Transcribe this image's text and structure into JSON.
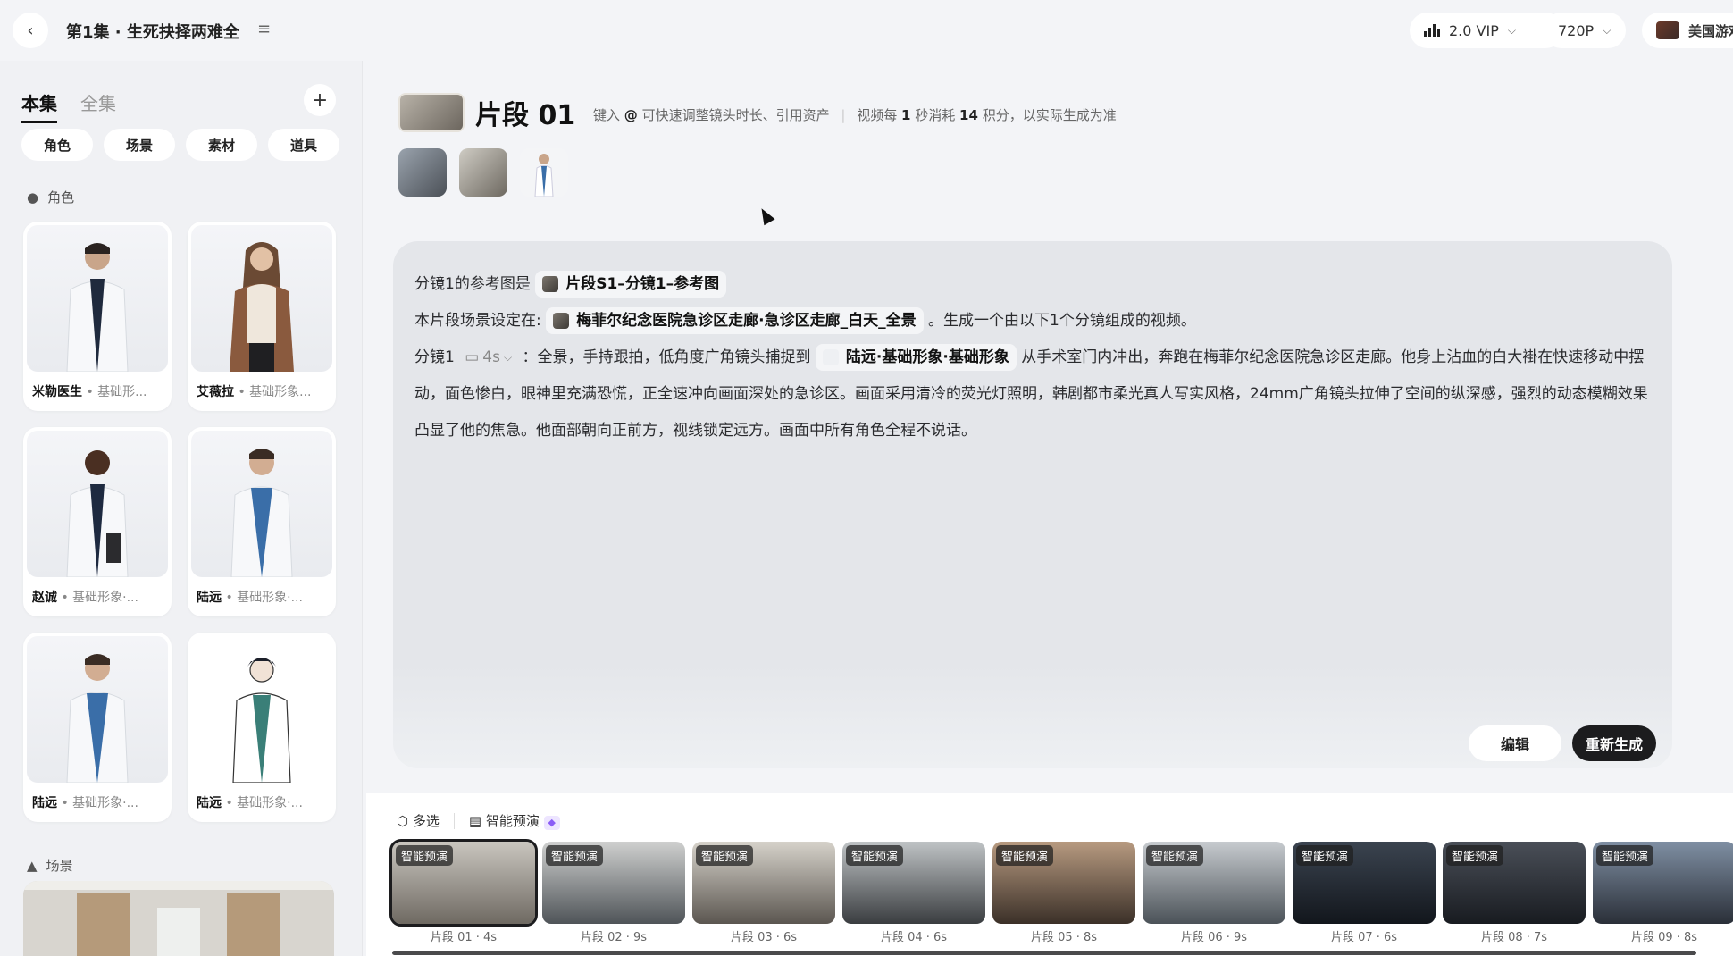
{
  "header": {
    "episode_title": "第1集 · 生死抉择两难全",
    "model_label": "2.0 VIP",
    "resolution_label": "720P",
    "user_label": "美国游戏"
  },
  "sidebar": {
    "tabs": [
      {
        "label": "本集",
        "active": true
      },
      {
        "label": "全集",
        "active": false
      }
    ],
    "filters": [
      "角色",
      "场景",
      "素材",
      "道具"
    ],
    "characters_section": "角色",
    "characters": [
      {
        "name": "米勒医生",
        "tag": "• 基础形..."
      },
      {
        "name": "艾薇拉",
        "tag": "• 基础形象..."
      },
      {
        "name": "赵诚",
        "tag": "• 基础形象·..."
      },
      {
        "name": "陆远",
        "tag": "• 基础形象·..."
      },
      {
        "name": "陆远",
        "tag": "• 基础形象·..."
      },
      {
        "name": "陆远",
        "tag": "• 基础形象·..."
      }
    ],
    "scenes_section": "场景"
  },
  "clip": {
    "title": "片段 01",
    "hint_pre": "键入",
    "hint_at": "@",
    "hint_mid": "可快速调整镜头时长、引用资产",
    "hint_cost_pre": "视频每",
    "hint_cost_sec": "1",
    "hint_cost_mid": "秒消耗",
    "hint_cost_points": "14",
    "hint_cost_post": "积分，以实际生成为准"
  },
  "prompt": {
    "line1_pre": "分镜1的参考图是",
    "line1_ref": "片段S1–分镜1–参考图",
    "line2_pre": "本片段场景设定在:",
    "line2_ref": "梅菲尔纪念医院急诊区走廊·急诊区走廊_白天_全景",
    "line2_post": "。生成一个由以下1个分镜组成的视频。",
    "shot_label": "分镜1",
    "shot_duration": "4s",
    "shot_pre": "：全景，手持跟拍，低角度广角镜头捕捉到",
    "shot_ref": "陆远·基础形象·基础形象",
    "shot_text": "从手术室门内冲出，奔跑在梅菲尔纪念医院急诊区走廊。他身上沾血的白大褂在快速移动中摆动，面色惨白，眼神里充满恐慌，正全速冲向画面深处的急诊区。画面采用清冷的荧光灯照明，韩剧都市柔光真人写实风格，24mm广角镜头拉伸了空间的纵深感，强烈的动态模糊效果凸显了他的焦急。他面部朝向正前方，视线锁定远方。画面中所有角色全程不说话。"
  },
  "actions": {
    "edit": "编辑",
    "regenerate": "重新生成"
  },
  "timeline": {
    "multi_select": "多选",
    "smart_preview": "智能预演",
    "clips": [
      {
        "badge": "智能预演",
        "label": "片段 01 · 4s",
        "colors": [
          "#c9c6bf",
          "#6f6a62"
        ]
      },
      {
        "badge": "智能预演",
        "label": "片段 02 · 9s",
        "colors": [
          "#cfd0cf",
          "#4f5458"
        ]
      },
      {
        "badge": "智能预演",
        "label": "片段 03 · 6s",
        "colors": [
          "#d6d2ca",
          "#5b5650"
        ]
      },
      {
        "badge": "智能预演",
        "label": "片段 04 · 6s",
        "colors": [
          "#bfc3c5",
          "#3a3d40"
        ]
      },
      {
        "badge": "智能预演",
        "label": "片段 05 · 8s",
        "colors": [
          "#b79a80",
          "#3b3028"
        ]
      },
      {
        "badge": "智能预演",
        "label": "片段 06 · 9s",
        "colors": [
          "#c7cbcf",
          "#4b5258"
        ]
      },
      {
        "badge": "智能预演",
        "label": "片段 07 · 6s",
        "colors": [
          "#3b4450",
          "#12161c"
        ]
      },
      {
        "badge": "智能预演",
        "label": "片段 08 · 7s",
        "colors": [
          "#4a4f58",
          "#181b20"
        ]
      },
      {
        "badge": "智能预演",
        "label": "片段 09 · 8s",
        "colors": [
          "#7f8fa3",
          "#2a2f38"
        ]
      }
    ]
  }
}
